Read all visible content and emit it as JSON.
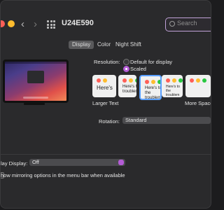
{
  "window": {
    "title": "U24E590"
  },
  "search": {
    "placeholder": "Search"
  },
  "tabs": [
    {
      "label": "Display",
      "selected": true
    },
    {
      "label": "Color",
      "selected": false
    },
    {
      "label": "Night Shift",
      "selected": false
    }
  ],
  "resolution": {
    "label": "Resolution:",
    "options": [
      {
        "label": "Default for display",
        "selected": false
      },
      {
        "label": "Scaled",
        "selected": true
      }
    ]
  },
  "scaled_previews": [
    {
      "text": "Here's",
      "selected": false
    },
    {
      "text": "Here's t troublem",
      "selected": false
    },
    {
      "text": "Here's to the troublem ones who",
      "selected": true
    },
    {
      "text": "Here's to the troublem ones who see things",
      "selected": false
    }
  ],
  "larger_text_label": "Larger Text",
  "more_space_label": "More Space",
  "rotation": {
    "label": "Rotation:",
    "value": "Standard"
  },
  "airplay": {
    "label": "lay Display:",
    "value": "Off"
  },
  "mirroring": {
    "label": "how mirroring options in the menu bar when available"
  },
  "colors": {
    "accent": "#b45cd6",
    "traffic_red": "#ff5f57",
    "traffic_yellow": "#febc2e",
    "traffic_green": "#28c840",
    "window_bg": "#2a2a2c"
  }
}
